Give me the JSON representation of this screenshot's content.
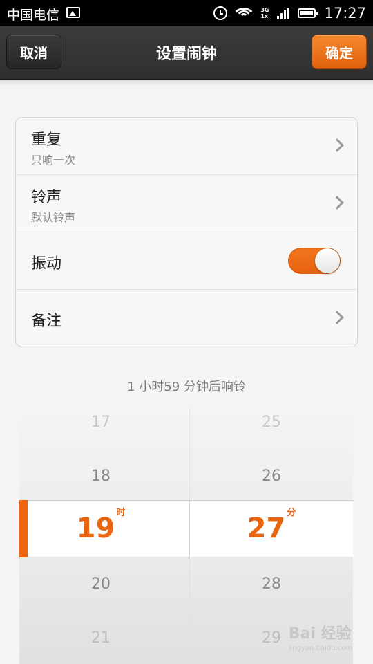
{
  "status_bar": {
    "carrier": "中国电信",
    "network_top": "3G",
    "network_bottom": "1x",
    "time": "17:27"
  },
  "nav": {
    "cancel_label": "取消",
    "title": "设置闹钟",
    "ok_label": "确定"
  },
  "settings": {
    "repeat": {
      "title": "重复",
      "value": "只响一次"
    },
    "ringtone": {
      "title": "铃声",
      "value": "默认铃声"
    },
    "vibrate": {
      "title": "振动",
      "enabled": true
    },
    "note": {
      "title": "备注"
    }
  },
  "countdown": "1 小时59 分钟后响铃",
  "picker": {
    "hours": {
      "above2": "17",
      "above1": "18",
      "selected": "19",
      "unit": "时",
      "below1": "20",
      "below2": "21"
    },
    "minutes": {
      "above2": "25",
      "above1": "26",
      "selected": "27",
      "unit": "分",
      "below1": "28",
      "below2": "29"
    }
  },
  "colors": {
    "accent": "#f0650c",
    "navbar": "#353535",
    "background": "#f4f4f4"
  },
  "watermark": {
    "text": "Bai 经验",
    "sub": "jingyan.baidu.com"
  }
}
